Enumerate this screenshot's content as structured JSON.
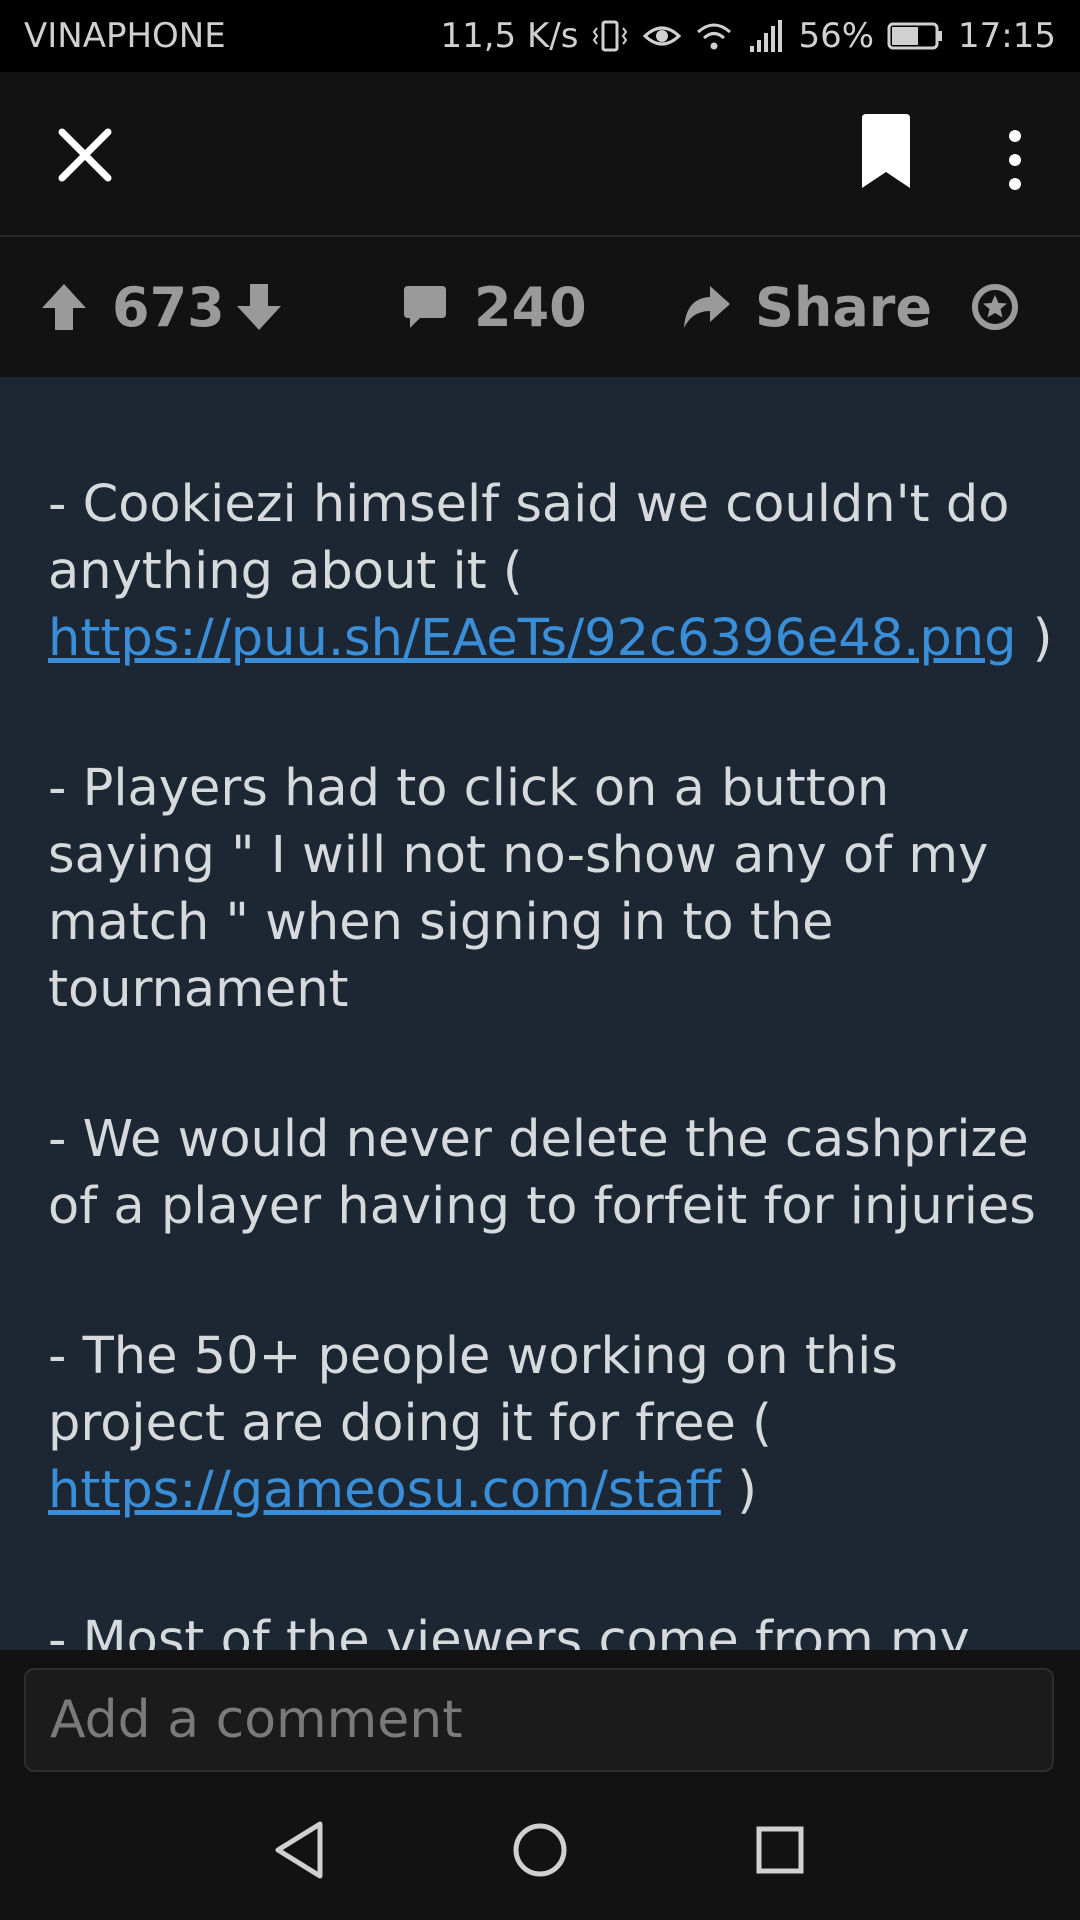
{
  "status_bar": {
    "carrier": "VINAPHONE",
    "net_speed": "11,5 K/s",
    "battery": "56%",
    "time": "17:15"
  },
  "app_bar": {
    "icons": [
      "close-icon",
      "bookmark-icon",
      "more-vertical-icon"
    ]
  },
  "action_bar": {
    "score": "673",
    "comments": "240",
    "share": "Share",
    "icons": [
      "upvote-icon",
      "downvote-icon",
      "comment-icon",
      "share-icon",
      "award-icon"
    ]
  },
  "post": {
    "p1_text_a": "- Cookiezi himself said we couldn't do anything about it ( ",
    "p1_link": "https://puu.sh/EAeTs/92c6396e48.png",
    "p1_text_b": " )",
    "p2": "- Players had to click on a button saying \" I will not no-show any of my match \" when signing in to the tournament",
    "p3": "- We would never delete the cashprize of a player having to forfeit for injuries",
    "p4_text_a": "- The 50+ people working on this project are doing it for free ( ",
    "p4_link": "https://gameosu.com/staff",
    "p4_text_b": " )",
    "p5": "- Most of the viewers come from my"
  },
  "comment_box": {
    "placeholder": "Add a comment"
  },
  "nav_bar": {
    "icons": [
      "back-icon",
      "home-icon",
      "recents-icon"
    ]
  },
  "colors": {
    "content_bg": "#1c2733",
    "bar_bg": "#121212",
    "text": "#d7dadc",
    "link": "#3a8ed8",
    "muted": "#9a9a9a"
  }
}
